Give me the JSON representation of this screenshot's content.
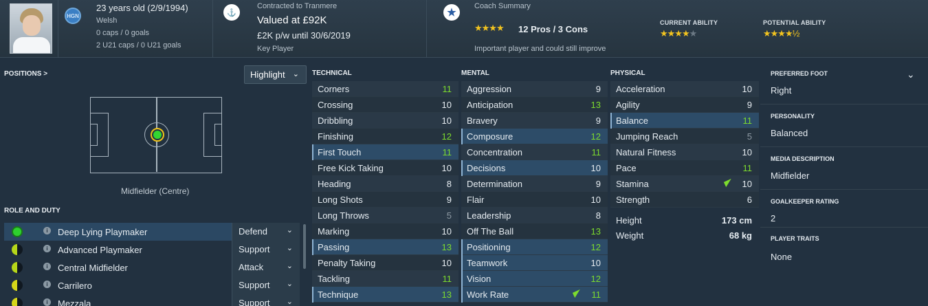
{
  "header": {
    "age": "23 years old (2/9/1994)",
    "nationality": "Welsh",
    "caps": "0 caps / 0 goals",
    "u21_caps": "2 U21 caps / 0 U21 goals",
    "badge_code": "HGN",
    "contract_label": "Contracted to Tranmere",
    "value": "Valued at £92K",
    "wage": "£2K p/w until 30/6/2019",
    "status": "Key Player",
    "coach_label": "Coach Summary",
    "coach_stars": "★★★★",
    "coach_summary": "12 Pros / 3 Cons",
    "coach_note": "Important player and could still improve",
    "current_ability_label": "CURRENT ABILITY",
    "current_ability_stars": "★★★★",
    "current_ability_grey": "★",
    "potential_ability_label": "POTENTIAL ABILITY",
    "potential_ability_stars": "★★★★½",
    "current_ability_rating": 4,
    "potential_ability_rating": 4.5
  },
  "positions": {
    "label": "POSITIONS >",
    "highlight": "Highlight",
    "position_name": "Midfielder (Centre)"
  },
  "roles": {
    "label": "ROLE AND DUTY",
    "items": [
      {
        "name": "Deep Lying Playmaker",
        "duty": "Defend",
        "color": "#2ed12e"
      },
      {
        "name": "Advanced Playmaker",
        "duty": "Support",
        "color": "#b6d619"
      },
      {
        "name": "Central Midfielder",
        "duty": "Attack",
        "color": "#b6d619"
      },
      {
        "name": "Carrilero",
        "duty": "Support",
        "color": "#d6d619"
      },
      {
        "name": "Mezzala",
        "duty": "Support",
        "color": "#d6d619"
      }
    ]
  },
  "attributes": {
    "technical_label": "TECHNICAL",
    "mental_label": "MENTAL",
    "physical_label": "PHYSICAL",
    "technical": [
      {
        "k": "Corners",
        "v": "11"
      },
      {
        "k": "Crossing",
        "v": "10"
      },
      {
        "k": "Dribbling",
        "v": "10"
      },
      {
        "k": "Finishing",
        "v": "12"
      },
      {
        "k": "First Touch",
        "v": "11"
      },
      {
        "k": "Free Kick Taking",
        "v": "10"
      },
      {
        "k": "Heading",
        "v": "8"
      },
      {
        "k": "Long Shots",
        "v": "9"
      },
      {
        "k": "Long Throws",
        "v": "5"
      },
      {
        "k": "Marking",
        "v": "10"
      },
      {
        "k": "Passing",
        "v": "13"
      },
      {
        "k": "Penalty Taking",
        "v": "10"
      },
      {
        "k": "Tackling",
        "v": "11"
      },
      {
        "k": "Technique",
        "v": "13"
      }
    ],
    "mental": [
      {
        "k": "Aggression",
        "v": "9"
      },
      {
        "k": "Anticipation",
        "v": "13"
      },
      {
        "k": "Bravery",
        "v": "9"
      },
      {
        "k": "Composure",
        "v": "12"
      },
      {
        "k": "Concentration",
        "v": "11"
      },
      {
        "k": "Decisions",
        "v": "10"
      },
      {
        "k": "Determination",
        "v": "9"
      },
      {
        "k": "Flair",
        "v": "10"
      },
      {
        "k": "Leadership",
        "v": "8"
      },
      {
        "k": "Off The Ball",
        "v": "13"
      },
      {
        "k": "Positioning",
        "v": "12"
      },
      {
        "k": "Teamwork",
        "v": "10"
      },
      {
        "k": "Vision",
        "v": "12"
      },
      {
        "k": "Work Rate",
        "v": "11"
      }
    ],
    "physical": [
      {
        "k": "Acceleration",
        "v": "10"
      },
      {
        "k": "Agility",
        "v": "9"
      },
      {
        "k": "Balance",
        "v": "11"
      },
      {
        "k": "Jumping Reach",
        "v": "5"
      },
      {
        "k": "Natural Fitness",
        "v": "10"
      },
      {
        "k": "Pace",
        "v": "11"
      },
      {
        "k": "Stamina",
        "v": "10"
      },
      {
        "k": "Strength",
        "v": "6"
      }
    ],
    "height_label": "Height",
    "height": "173 cm",
    "weight_label": "Weight",
    "weight": "68 kg"
  },
  "info": {
    "foot_label": "PREFERRED FOOT",
    "foot": "Right",
    "personality_label": "PERSONALITY",
    "personality": "Balanced",
    "media_label": "MEDIA DESCRIPTION",
    "media": "Midfielder",
    "gk_label": "GOALKEEPER RATING",
    "gk": "2",
    "traits_label": "PLAYER TRAITS",
    "traits": "None"
  }
}
